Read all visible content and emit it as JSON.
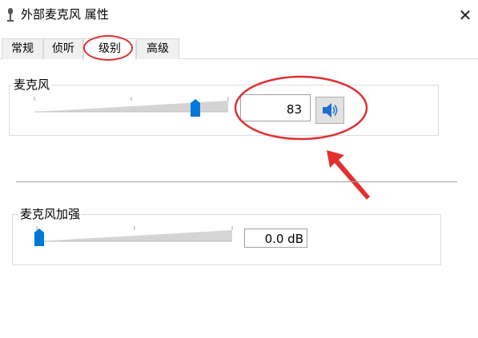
{
  "window": {
    "title": "外部麦克风 属性",
    "title_icon": "microphone-icon",
    "close_glyph": "✕"
  },
  "tabs": [
    {
      "label": "常规"
    },
    {
      "label": "侦听"
    },
    {
      "label": "级别",
      "active": true
    },
    {
      "label": "高级"
    }
  ],
  "microphone": {
    "label": "麦克风",
    "level": 83,
    "level_max": 100,
    "value_text": "83",
    "mute_icon": "speaker-icon"
  },
  "boost": {
    "label": "麦克风加强",
    "level_fraction": 0.0,
    "value_text": "0.0 dB"
  },
  "colors": {
    "accent": "#0078d7",
    "annotation": "#e03030"
  }
}
